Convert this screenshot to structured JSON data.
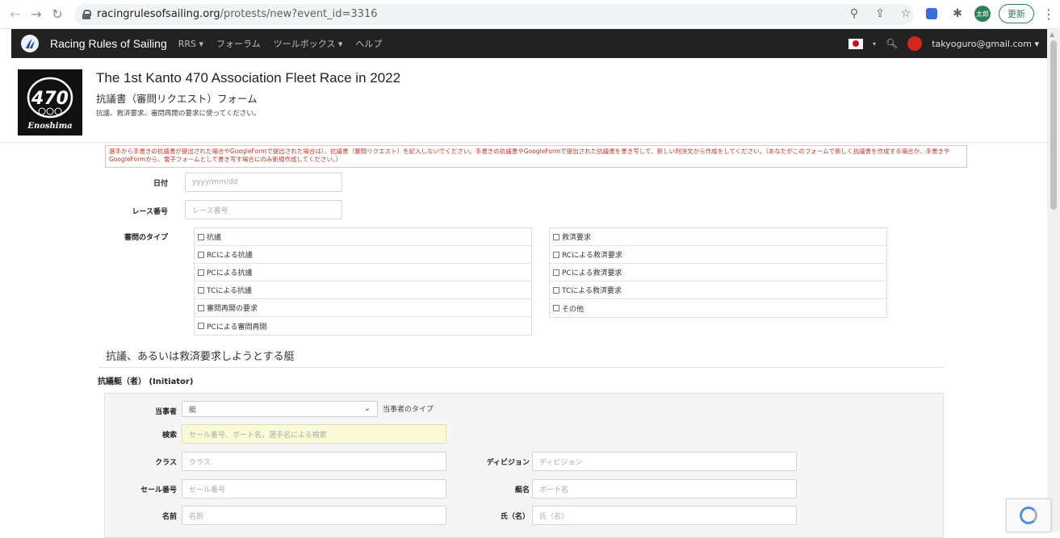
{
  "browser": {
    "url_host": "racingrulesofsailing.org",
    "url_path": "/protests/new?event_id=3316",
    "profile_badge": "太郎",
    "update_label": "更新"
  },
  "navbar": {
    "brand": "Racing Rules of Sailing",
    "items": [
      {
        "label": "RRS ▾"
      },
      {
        "label": "フォーラム"
      },
      {
        "label": "ツールボックス ▾"
      },
      {
        "label": "ヘルプ"
      }
    ],
    "user_email": "takyoguro@gmail.com ▾"
  },
  "header": {
    "event_title": "The 1st Kanto 470 Association Fleet Race in 2022",
    "form_title": "抗議書（審問リクエスト）フォーム",
    "form_desc": "抗議、救済要求、審問再開の要求に使ってください。",
    "logo_text": "Enoshima",
    "logo_number": "470"
  },
  "notice": "選手から手書きの抗議書が提出された場合やGoogleFormで提出された場合は）、抗議書（審問リクエスト）を記入しないでください。手書きの抗議書やGoogleFormで提出された抗議書を書き写して、新しい判決文から作成をしてください。（あなたがこのフォームで新しく抗議書を作成する場合か、手書きやGoogleFormから、電子フォームとして書き写す場合にのみ新規作成してください。）",
  "form": {
    "date_label": "日付",
    "date_placeholder": "yyyy/mm/dd",
    "race_label": "レース番号",
    "race_placeholder": "レース番号",
    "type_label": "審問のタイプ",
    "types_left": [
      {
        "label": "抗議"
      },
      {
        "label": "RCによる抗議"
      },
      {
        "label": "PCによる抗議"
      },
      {
        "label": "TCによる抗議"
      },
      {
        "label": "審問再開の要求"
      },
      {
        "label": "PCによる審問再開"
      }
    ],
    "types_right": [
      {
        "label": "救済要求"
      },
      {
        "label": "RCによる救済要求"
      },
      {
        "label": "PCによる救済要求"
      },
      {
        "label": "TCによる救済要求"
      },
      {
        "label": "その他"
      }
    ]
  },
  "section": {
    "heading": "抗議、あるいは救済要求しようとする艇",
    "initiator_heading": "抗議艇（者） (Initiator)"
  },
  "initiator": {
    "party_label": "当事者",
    "party_value": "艇",
    "party_type_label": "当事者のタイプ",
    "search_label": "検索",
    "search_placeholder": "セール番号、ボート名、選手名による検索",
    "class_label": "クラス",
    "class_placeholder": "クラス",
    "division_label": "ディビジョン",
    "division_placeholder": "ディビジョン",
    "sail_label": "セール番号",
    "sail_placeholder": "セール番号",
    "boat_label": "艇名",
    "boat_placeholder": "ボート名",
    "name_label": "名前",
    "name_placeholder": "名前",
    "surname_label": "氏（名）",
    "surname_placeholder": "氏（名）"
  },
  "colors": {
    "navbar_bg": "#222222",
    "notice_red": "#c0392b",
    "search_highlight": "#fafbd6"
  }
}
